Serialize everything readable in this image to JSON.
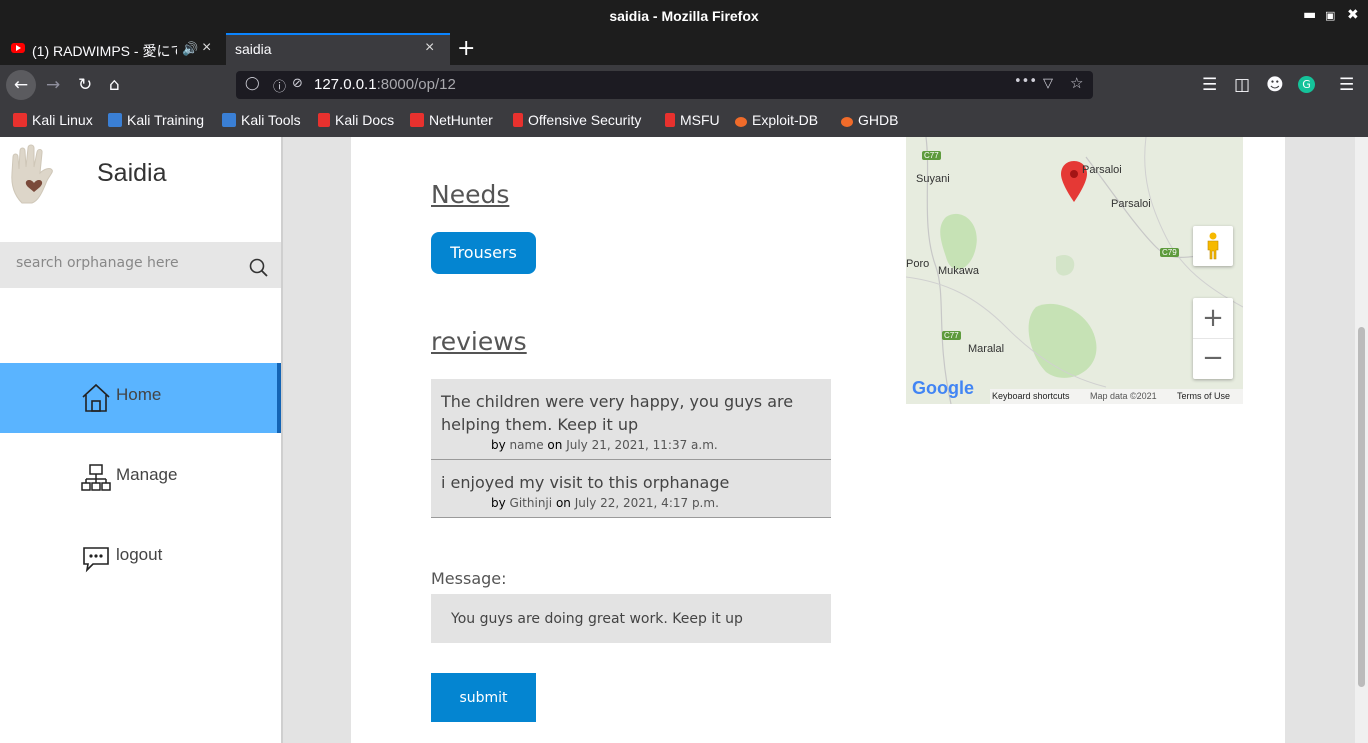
{
  "window": {
    "title": "saidia - Mozilla Firefox"
  },
  "tabs": [
    {
      "label": "(1) RADWIMPS - 愛にて",
      "icon": "youtube-icon",
      "audio": true
    },
    {
      "label": "saidia",
      "icon": "none",
      "active": true
    }
  ],
  "urlbar": {
    "host": "127.0.0.1",
    "path": ":8000/op/12"
  },
  "bookmarks": [
    {
      "label": "Kali Linux",
      "color": "#e8312e"
    },
    {
      "label": "Kali Training",
      "color": "#3a7fd5"
    },
    {
      "label": "Kali Tools",
      "color": "#3a7fd5"
    },
    {
      "label": "Kali Docs",
      "color": "#e8312e"
    },
    {
      "label": "NetHunter",
      "color": "#e8312e"
    },
    {
      "label": "Offensive Security",
      "color": "#e8312e"
    },
    {
      "label": "MSFU",
      "color": "#e8312e"
    },
    {
      "label": "Exploit-DB",
      "color": "#f06b2a"
    },
    {
      "label": "GHDB",
      "color": "#f06b2a"
    }
  ],
  "sidebar": {
    "brand": "Saidia",
    "search_placeholder": "search orphanage here",
    "items": [
      {
        "label": "Home",
        "icon": "home-icon",
        "active": true
      },
      {
        "label": "Manage",
        "icon": "network-icon"
      },
      {
        "label": "logout",
        "icon": "chat-icon"
      }
    ]
  },
  "main": {
    "needs_heading": "Needs",
    "needs": [
      "Trousers"
    ],
    "reviews_heading": "reviews",
    "by_word": "by",
    "on_word": "on",
    "reviews": [
      {
        "text": "The children were very happy, you guys are helping them. Keep it up",
        "author": "name",
        "date": "July 21, 2021, 11:37 a.m."
      },
      {
        "text": "i enjoyed my visit to this orphanage",
        "author": "Githinji",
        "date": "July 22, 2021, 4:17 p.m."
      }
    ],
    "message_label": "Message:",
    "message_value": "You guys are doing great work. Keep it up",
    "submit_label": "submit"
  },
  "map": {
    "labels": {
      "suyani": "Suyani",
      "parsaloi1": "Parsaloi",
      "parsaloi2": "Parsaloi",
      "poro": "Poro",
      "mukawa": "Mukawa",
      "maralal": "Maralal"
    },
    "roads": {
      "c77a": "C77",
      "c77b": "C77",
      "c79": "C79"
    },
    "logo": "Google",
    "footer": {
      "shortcuts": "Keyboard shortcuts",
      "mapdata": "Map data ©2021",
      "terms": "Terms of Use"
    },
    "colors": {
      "marker": "#e53935",
      "land": "#e7ecdf",
      "forest": "#c6e2b5"
    }
  },
  "colors": {
    "accent": "#0485d1",
    "nav_active": "#5ab4ff",
    "nav_active_border": "#1464b4"
  }
}
